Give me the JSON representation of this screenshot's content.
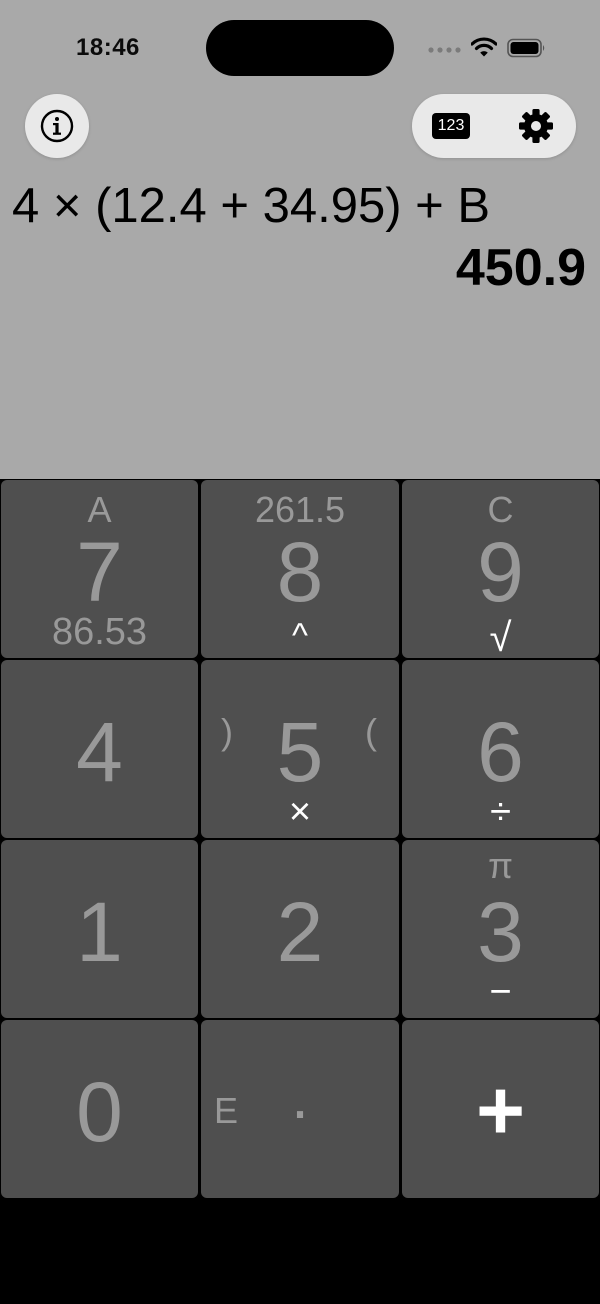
{
  "status_bar": {
    "time": "18:46"
  },
  "top_bar": {
    "mode_label": "123"
  },
  "display": {
    "expression": "4 × (12.4 + 34.95) + B",
    "result": "450.9"
  },
  "keypad": {
    "keys": [
      {
        "main": "7",
        "top": "A",
        "bottom": "86.53"
      },
      {
        "main": "8",
        "top": "261.5",
        "op": "^"
      },
      {
        "main": "9",
        "top": "C",
        "op": "√"
      },
      {
        "main": "4"
      },
      {
        "main": "5",
        "left": ")",
        "right": "(",
        "op": "×"
      },
      {
        "main": "6",
        "op": "÷"
      },
      {
        "main": "1"
      },
      {
        "main": "2"
      },
      {
        "main": "3",
        "top": "π",
        "op": "−"
      },
      {
        "main": "0"
      },
      {
        "main": "·",
        "left": "E"
      },
      {
        "main": "+"
      }
    ]
  },
  "colors": {
    "background": "#a9a9a9",
    "key": "#4f4f4f",
    "key_text": "#999999",
    "operator_text": "#ffffff"
  },
  "icons": [
    "info-icon",
    "number-mode-icon",
    "gear-icon",
    "signal-icon",
    "wifi-icon",
    "battery-icon"
  ]
}
